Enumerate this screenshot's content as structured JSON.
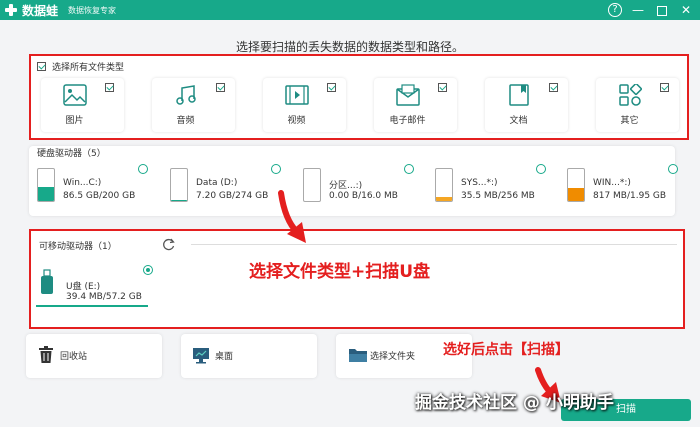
{
  "titlebar": {
    "app_name": "数据蛙",
    "app_subtitle": "数据恢复专家",
    "help_label": "?",
    "min_label": "—",
    "close_label": "✕",
    "bg_color": "#17a98a"
  },
  "instruction": "选择要扫描的丢失数据的数据类型和路径。",
  "file_types": {
    "select_all_label": "选择所有文件类型",
    "items": [
      {
        "label": "图片",
        "icon": "image-icon"
      },
      {
        "label": "音频",
        "icon": "music-icon"
      },
      {
        "label": "视频",
        "icon": "video-icon"
      },
      {
        "label": "电子邮件",
        "icon": "mail-icon"
      },
      {
        "label": "文档",
        "icon": "document-icon"
      },
      {
        "label": "其它",
        "icon": "other-icon"
      }
    ]
  },
  "hdd": {
    "title": "硬盘驱动器（5）",
    "drives": [
      {
        "name": "Win...C:)",
        "size": "86.5 GB/200 GB",
        "fill_color": "#17a98a",
        "fill": 0.43
      },
      {
        "name": "Data (D:)",
        "size": "7.20 GB/274 GB",
        "fill_color": "#17a98a",
        "fill": 0.03
      },
      {
        "name": "分区...:)",
        "size": "0.00  B/16.0 MB",
        "fill_color": "#17a98a",
        "fill": 0
      },
      {
        "name": "SYS...*:)",
        "size": "35.5 MB/256 MB",
        "fill_color": "#f5a623",
        "fill": 0.14
      },
      {
        "name": "WIN...*:)",
        "size": "817 MB/1.95 GB",
        "fill_color": "#f08c00",
        "fill": 0.41
      }
    ]
  },
  "usb": {
    "title": "可移动驱动器（1）",
    "drive": {
      "name": "U盘 (E:)",
      "size": "39.4 MB/57.2 GB"
    }
  },
  "bottom": {
    "items": [
      {
        "label": "回收站",
        "icon": "recycle-bin-icon"
      },
      {
        "label": "桌面",
        "icon": "desktop-icon"
      },
      {
        "label": "选择文件夹",
        "icon": "folder-icon"
      }
    ]
  },
  "scan_button_label": "扫描",
  "annotations": {
    "type_and_usb": "选择文件类型+扫描U盘",
    "click_scan": "选好后点击【扫描】",
    "color": "#e41f1f"
  },
  "watermark": "掘金技术社区 @ 小明助手"
}
